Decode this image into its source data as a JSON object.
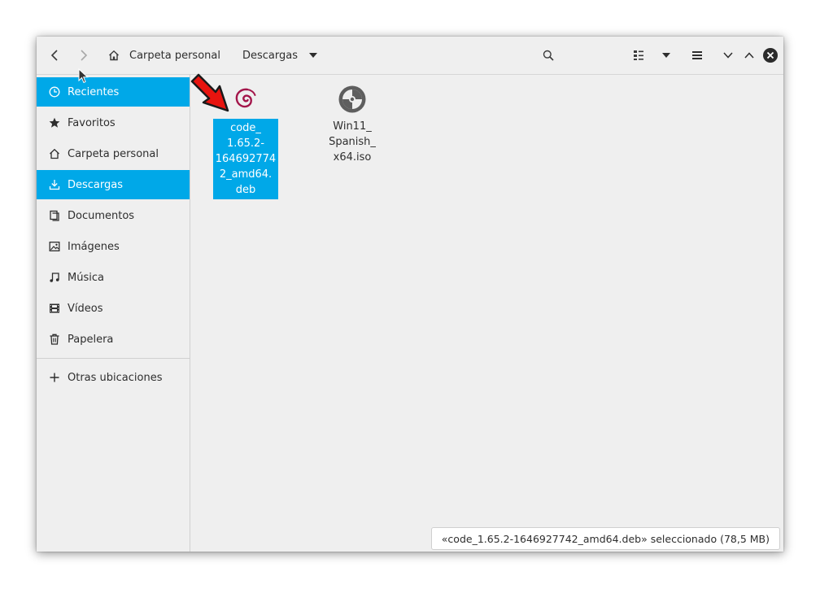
{
  "header": {
    "breadcrumbs": [
      {
        "label": "Carpeta personal",
        "icon": "home-icon"
      },
      {
        "label": "Descargas"
      }
    ],
    "accent": "#00a8e8"
  },
  "sidebar": {
    "items": [
      {
        "label": "Recientes",
        "icon": "clock-icon",
        "active": true
      },
      {
        "label": "Favoritos",
        "icon": "star-icon"
      },
      {
        "label": "Carpeta personal",
        "icon": "home-icon"
      },
      {
        "label": "Descargas",
        "icon": "download-icon",
        "active": true
      },
      {
        "label": "Documentos",
        "icon": "document-icon"
      },
      {
        "label": "Imágenes",
        "icon": "image-icon"
      },
      {
        "label": "Música",
        "icon": "music-icon"
      },
      {
        "label": "Vídeos",
        "icon": "film-icon"
      },
      {
        "label": "Papelera",
        "icon": "trash-icon"
      }
    ],
    "other": {
      "label": "Otras ubicaciones",
      "icon": "plus-icon"
    }
  },
  "files": [
    {
      "name": "code_\n1.65.2-\n164692774\n2_amd64.\ndeb",
      "icon": "debian-icon",
      "selected": true
    },
    {
      "name": "Win11_\nSpanish_\nx64.iso",
      "icon": "disc-image-icon",
      "selected": false
    }
  ],
  "status": {
    "text": "«code_1.65.2-1646927742_amd64.deb» seleccionado  (78,5 MB)"
  }
}
